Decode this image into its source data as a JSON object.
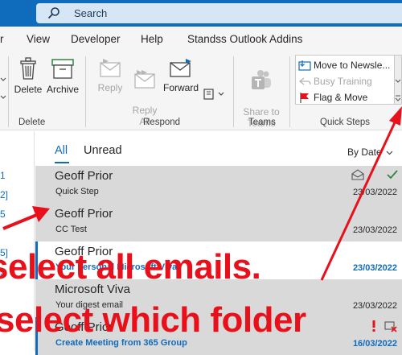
{
  "search": {
    "placeholder": "Search"
  },
  "menu": {
    "items": [
      {
        "label": "r"
      },
      {
        "label": "View"
      },
      {
        "label": "Developer"
      },
      {
        "label": "Help"
      },
      {
        "label": "Standss Outlook Addins"
      }
    ]
  },
  "ribbon": {
    "delete_label": "Delete",
    "archive_label": "Archive",
    "reply_label": "Reply",
    "reply_all_label": "Reply\nAll",
    "forward_label": "Forward",
    "share_teams_label": "Share to\nTeams",
    "groups": {
      "delete": "Delete",
      "respond": "Respond",
      "teams": "Teams",
      "quick_steps": "Quick Steps"
    },
    "quick_steps": [
      {
        "label": "Move to Newsle..."
      },
      {
        "label": "Busy Training"
      },
      {
        "label": "Flag & Move"
      }
    ]
  },
  "left_pane": {
    "items": [
      "1",
      "2]",
      "5",
      "5]",
      "5"
    ]
  },
  "mail_list": {
    "tabs": {
      "all": "All",
      "unread": "Unread"
    },
    "sort_label": "By Date",
    "emails": [
      {
        "sender": "Geoff Prior",
        "subject": "Quick Step",
        "date": "23/03/2022",
        "selected": true,
        "unread": false
      },
      {
        "sender": "Geoff Prior",
        "subject": "CC Test",
        "date": "23/03/2022",
        "selected": true,
        "unread": false
      },
      {
        "sender": "Geoff Prior",
        "subject": "Your personal Microsoft Viva",
        "date": "23/03/2022",
        "selected": false,
        "unread": true
      },
      {
        "sender": "Microsoft Viva",
        "subject": "Your digest email",
        "date": "23/03/2022",
        "selected": true,
        "unread": false
      },
      {
        "sender": "Geoff Prior",
        "subject": "Create Meeting from 365 Group",
        "date": "16/03/2022",
        "selected": true,
        "unread": true
      }
    ]
  },
  "overlay": {
    "line1": "select all emails.",
    "line2": "select which folder",
    "color": "#e8101a"
  }
}
